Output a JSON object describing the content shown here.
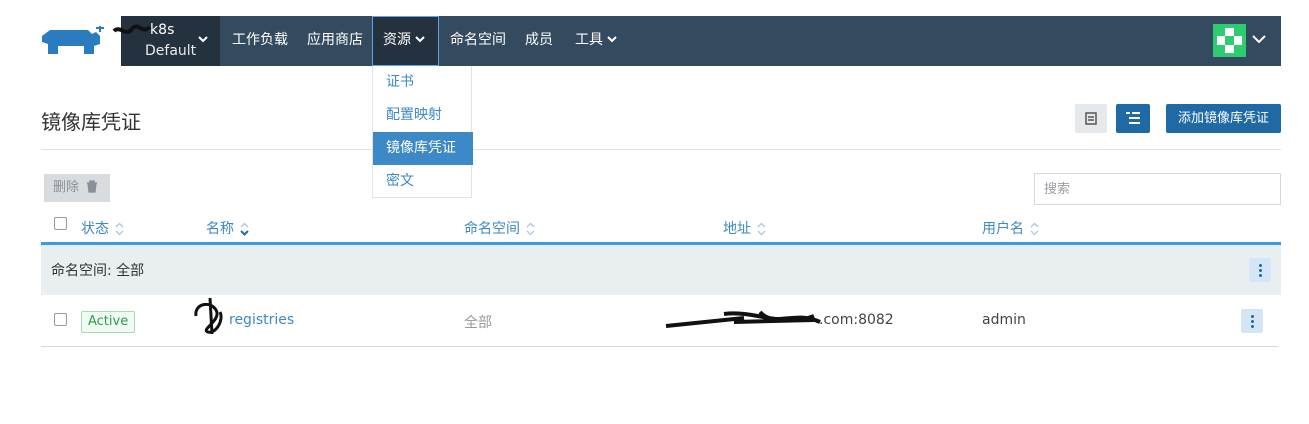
{
  "header": {
    "cluster_name": "-k8s",
    "project_name": "Default",
    "nav": [
      "工作负载",
      "应用商店",
      "资源",
      "命名空间",
      "成员",
      "工具"
    ]
  },
  "dropdown": {
    "items": [
      "证书",
      "配置映射",
      "镜像库凭证",
      "密文"
    ],
    "selected": "镜像库凭证"
  },
  "page": {
    "title": "镜像库凭证",
    "add_button": "添加镜像库凭证",
    "delete_button": "删除",
    "search_placeholder": "搜索"
  },
  "table": {
    "columns": [
      "状态",
      "名称",
      "命名空间",
      "地址",
      "用户名"
    ],
    "group_label": "命名空间: 全部",
    "rows": [
      {
        "state": "Active",
        "name": "registries",
        "namespace": "全部",
        "address": ".com:8082",
        "username": "admin"
      }
    ]
  },
  "colors": {
    "header_bg": "#344a5f",
    "accent": "#3d88c6",
    "primary_button": "#1f6aa5",
    "active_badge": "#2e9c4f"
  }
}
